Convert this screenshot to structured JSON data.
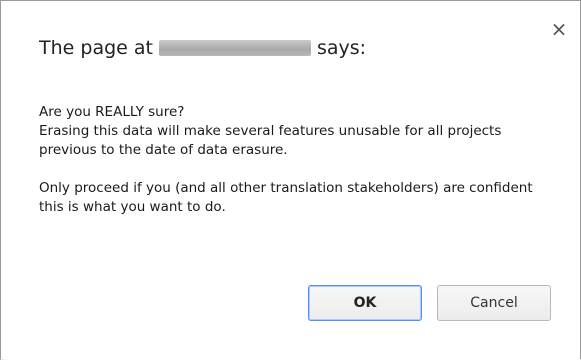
{
  "dialog": {
    "title_prefix": "The page at",
    "title_suffix": "says:",
    "message_paragraphs": [
      "Are you REALLY sure?\nErasing this data will make several features unusable for all projects previous to the date of data erasure.",
      "Only proceed if you (and all other translation stakeholders) are confident this is what you want to do."
    ],
    "close_symbol": "×",
    "ok_label": "OK",
    "cancel_label": "Cancel"
  },
  "colors": {
    "focus_border": "#4d90fe",
    "text": "#222222"
  }
}
